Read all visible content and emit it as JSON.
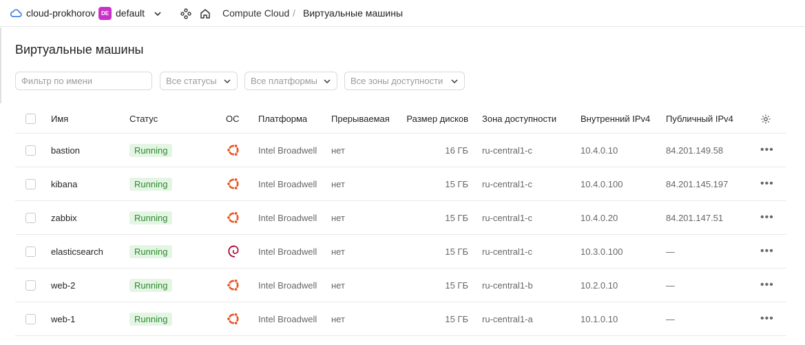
{
  "header": {
    "cloud_name": "cloud-prokhorov",
    "folder_badge": "DE",
    "folder_name": "default",
    "service": "Compute Cloud",
    "separator": "/",
    "current": "Виртуальные машины"
  },
  "page": {
    "title": "Виртуальные машины"
  },
  "filters": {
    "name_placeholder": "Фильтр по имени",
    "status": "Все статусы",
    "platform": "Все платформы",
    "zone": "Все зоны доступности"
  },
  "table": {
    "columns": {
      "name": "Имя",
      "status": "Статус",
      "os": "ОС",
      "platform": "Платформа",
      "preemptible": "Прерываемая",
      "disk": "Размер дисков",
      "zone": "Зона доступности",
      "ip_internal": "Внутренний IPv4",
      "ip_public": "Публичный IPv4"
    },
    "rows": [
      {
        "name": "bastion",
        "status": "Running",
        "os": "ubuntu",
        "platform": "Intel Broadwell",
        "preemptible": "нет",
        "disk": "16 ГБ",
        "zone": "ru-central1-c",
        "ip_internal": "10.4.0.10",
        "ip_public": "84.201.149.58"
      },
      {
        "name": "kibana",
        "status": "Running",
        "os": "ubuntu",
        "platform": "Intel Broadwell",
        "preemptible": "нет",
        "disk": "15 ГБ",
        "zone": "ru-central1-c",
        "ip_internal": "10.4.0.100",
        "ip_public": "84.201.145.197"
      },
      {
        "name": "zabbix",
        "status": "Running",
        "os": "ubuntu",
        "platform": "Intel Broadwell",
        "preemptible": "нет",
        "disk": "15 ГБ",
        "zone": "ru-central1-c",
        "ip_internal": "10.4.0.20",
        "ip_public": "84.201.147.51"
      },
      {
        "name": "elasticsearch",
        "status": "Running",
        "os": "debian",
        "platform": "Intel Broadwell",
        "preemptible": "нет",
        "disk": "15 ГБ",
        "zone": "ru-central1-c",
        "ip_internal": "10.3.0.100",
        "ip_public": "—"
      },
      {
        "name": "web-2",
        "status": "Running",
        "os": "ubuntu",
        "platform": "Intel Broadwell",
        "preemptible": "нет",
        "disk": "15 ГБ",
        "zone": "ru-central1-b",
        "ip_internal": "10.2.0.10",
        "ip_public": "—"
      },
      {
        "name": "web-1",
        "status": "Running",
        "os": "ubuntu",
        "platform": "Intel Broadwell",
        "preemptible": "нет",
        "disk": "15 ГБ",
        "zone": "ru-central1-a",
        "ip_internal": "10.1.0.10",
        "ip_public": "—"
      }
    ]
  },
  "icons": {
    "cloud": "cloud-icon",
    "graph": "graph-icon",
    "home": "home-icon",
    "settings": "gear-icon",
    "actions": "more-icon"
  },
  "colors": {
    "accent": "#2f6fe0",
    "folder_badge": "#c832c8",
    "ubuntu": "#e95420",
    "debian": "#a80030",
    "running_bg": "#e4f5e4",
    "running_text": "#2b8a2b"
  }
}
